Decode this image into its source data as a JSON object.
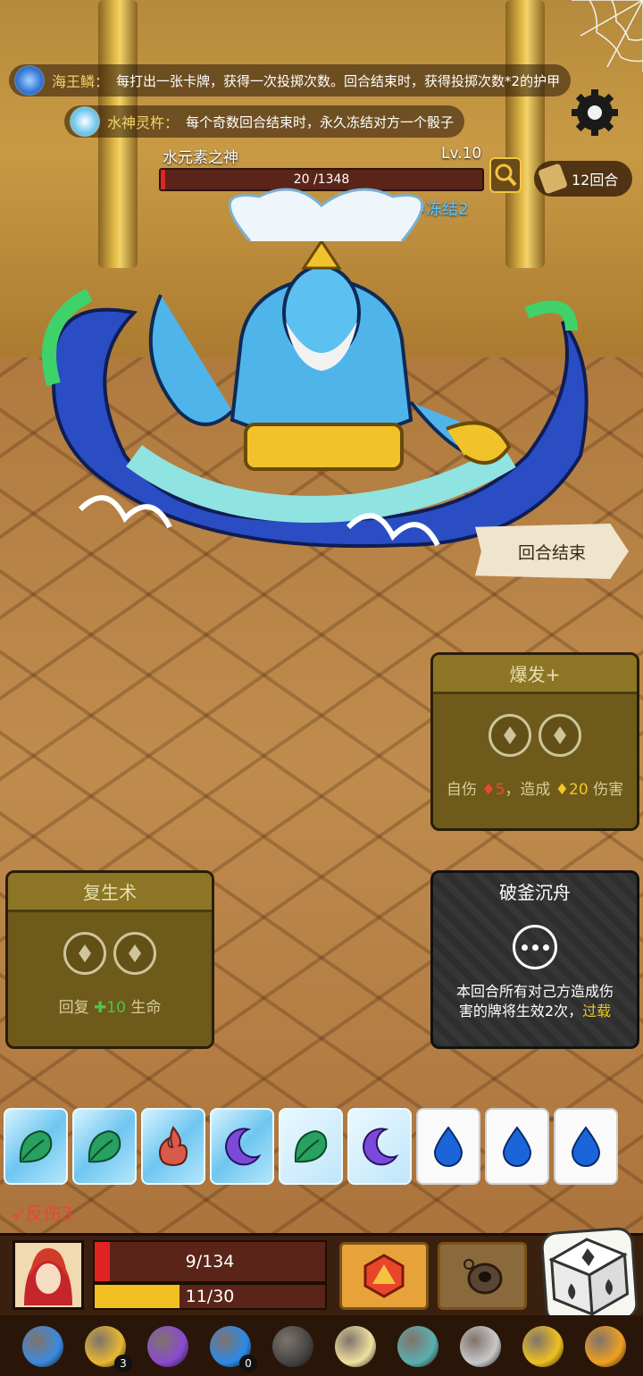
{
  "relics_info": [
    {
      "name": "海王鳞",
      "sep": "：",
      "desc": "每打出一张卡牌，获得一次投掷次数。回合结束时，获得投掷次数*2的护甲",
      "icon": "scale-icon"
    },
    {
      "name": "水神灵杵",
      "sep": "：",
      "desc": "每个奇数回合结束时，永久冻结对方一个骰子",
      "icon": "water-pestle-icon"
    }
  ],
  "enemy": {
    "name": "水元素之神",
    "level": "Lv.10",
    "hp_text": "20 /1348",
    "hp_fraction": 0.015,
    "status": "冻结2"
  },
  "round_label": "12回合",
  "end_turn_label": "回合结束",
  "cards": {
    "burst": {
      "title": "爆发+",
      "desc_prefix": "自伤 ",
      "self_damage": "♦5",
      "desc_mid": "，造成 ",
      "damage": "♦20",
      "desc_suffix": " 伤害"
    },
    "revive": {
      "title": "复生术",
      "desc_prefix": "回复 ",
      "heal": "✚10",
      "desc_suffix": " 生命"
    },
    "break_boats": {
      "title": "破釜沉舟",
      "desc_line1": "本回合所有对己方造成伤",
      "desc_line2": "害的牌将生效2次，",
      "keyword": "过载"
    }
  },
  "dice": [
    {
      "face": "leaf",
      "state": "frozen"
    },
    {
      "face": "leaf",
      "state": "frozen"
    },
    {
      "face": "fire",
      "state": "frozen"
    },
    {
      "face": "moon",
      "state": "frozen"
    },
    {
      "face": "leaf",
      "state": "frozen-light"
    },
    {
      "face": "moon",
      "state": "frozen-light"
    },
    {
      "face": "water",
      "state": "clear"
    },
    {
      "face": "water",
      "state": "clear"
    },
    {
      "face": "water",
      "state": "clear"
    }
  ],
  "player": {
    "thorns": "反伤3",
    "hp_text": "9/134",
    "hp_fraction": 0.067,
    "shield_text": "11/30",
    "shield_fraction": 0.367
  },
  "relic_bar": [
    {
      "icon": "spiked-ball-icon",
      "count": ""
    },
    {
      "icon": "gold-bag-icon",
      "count": "3"
    },
    {
      "icon": "purple-cloth-icon",
      "count": ""
    },
    {
      "icon": "water-orb-icon",
      "count": "0"
    },
    {
      "icon": "black-pot-icon",
      "count": ""
    },
    {
      "icon": "sun-disc-icon",
      "count": ""
    },
    {
      "icon": "jade-vase-icon",
      "count": ""
    },
    {
      "icon": "silver-flame-icon",
      "count": ""
    },
    {
      "icon": "gold-drum-icon",
      "count": ""
    },
    {
      "icon": "crown-icon",
      "count": ""
    }
  ],
  "colors": {
    "hp": "#e02424",
    "shield": "#f2c022",
    "freeze": "#5ac8ff",
    "gold": "#f0c828"
  }
}
